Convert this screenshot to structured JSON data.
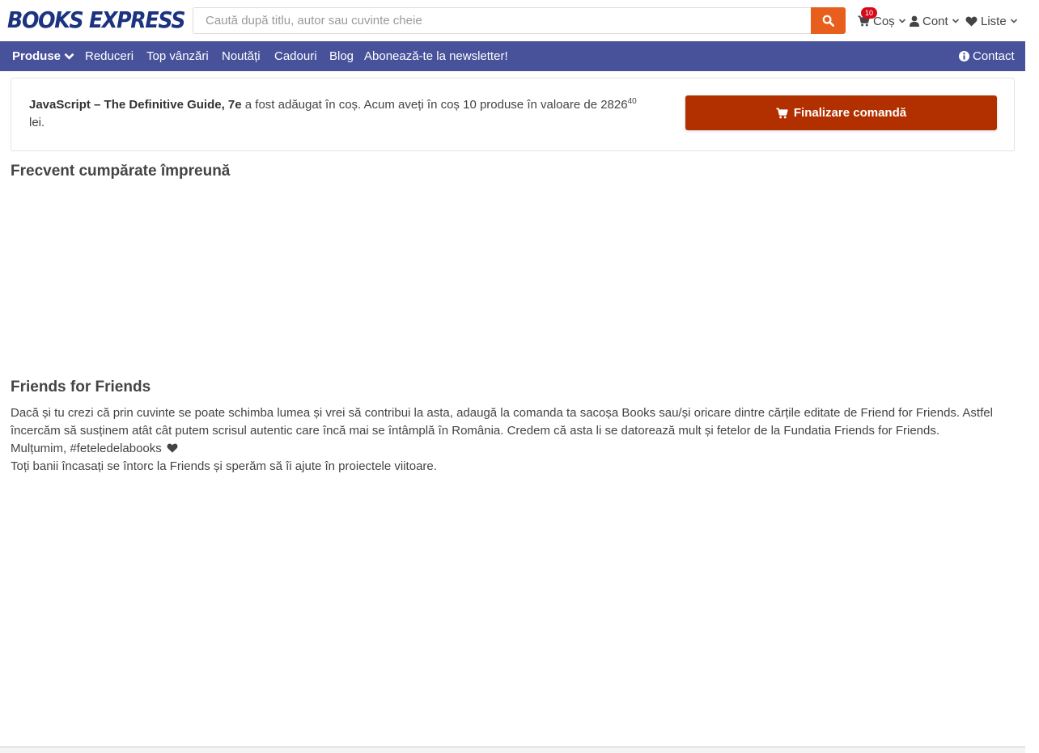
{
  "header": {
    "logo_text": "BOOKS EXPRESS",
    "search_placeholder": "Caută după titlu, autor sau cuvinte cheie",
    "cart_label": "Coș",
    "cart_count": "10",
    "account_label": "Cont",
    "lists_label": "Liste"
  },
  "navbar": {
    "products_label": "Produse",
    "items": [
      "Reduceri",
      "Top vânzări",
      "Noutăți",
      "Cadouri",
      "Blog",
      "Abonează-te la newsletter!"
    ],
    "contact_label": "Contact"
  },
  "notice": {
    "product_title": "JavaScript – The Definitive Guide, 7e",
    "message_part1": " a fost adăugat în coș. Acum aveți în coș 10 produse în valoare de ",
    "price_main": "2826",
    "price_cents": "40",
    "currency": " lei.",
    "checkout_label": "Finalizare comandă"
  },
  "sections": {
    "frequent_title": "Frecvent cumpărate împreună",
    "friends_title": "Friends for Friends",
    "friends_paragraph": "Dacă și tu crezi că prin cuvinte se poate schimba lumea și vrei să contribui la asta, adaugă la comanda ta sacoșa Books sau/și oricare dintre cărțile editate de Friend for Friends. Astfel încercăm să susținem atât cât putem scrisul autentic care încă mai se întâmplă în România. Credem că asta li se datorează mult și fetelor de la Fundatia Friends for Friends.",
    "friends_thanks": "Mulțumim, #feteledelabooks",
    "friends_footer": "Toți banii încasați se întorc la Friends și sperăm să îi ajute în proiectele viitoare."
  },
  "colors": {
    "navbar_bg": "#47529a",
    "logo": "#1c3380",
    "search_button": "#e85e1c",
    "checkout_button": "#b23000",
    "badge": "#d40b1b"
  },
  "icons": {
    "search": "search-icon",
    "cart": "cart-icon",
    "account": "user-icon",
    "lists": "heart-icon",
    "dropdown": "chevron-down-icon",
    "contact": "info-icon",
    "checkout": "cart-icon",
    "thanks": "heart-icon"
  }
}
